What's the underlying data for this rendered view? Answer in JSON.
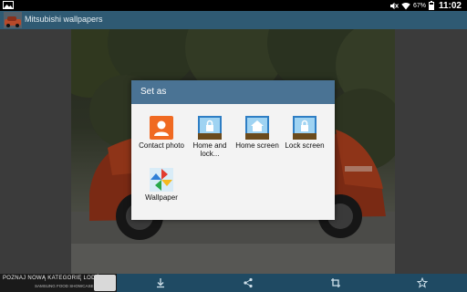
{
  "status_bar": {
    "battery": "67%",
    "time": "11:02"
  },
  "action_bar": {
    "title": "Mitsubishi wallpapers"
  },
  "dialog": {
    "title": "Set as",
    "options": [
      {
        "label": "Contact photo",
        "icon": "contact-icon",
        "color": "#f06a22"
      },
      {
        "label": "Home and lock...",
        "icon": "home-lock-icon",
        "color": "#3d8fd1"
      },
      {
        "label": "Home screen",
        "icon": "home-icon",
        "color": "#3d8fd1"
      },
      {
        "label": "Lock screen",
        "icon": "lock-icon",
        "color": "#3d8fd1"
      },
      {
        "label": "Wallpaper",
        "icon": "pinwheel-icon",
        "color": "#4aa3df"
      }
    ]
  },
  "bottom_bar": {
    "ad_text": "POZNAJ NOWĄ KATEGORIĘ LODÓWEK",
    "ad_subtext": "SAMSUNG FOOD SHOWCASE",
    "buttons": [
      "download-icon",
      "share-icon",
      "crop-icon",
      "star-icon"
    ]
  },
  "colors": {
    "action_bar": "#2f5a73",
    "dialog_header": "#4a7394",
    "bottom_bar": "#1f4a63"
  }
}
